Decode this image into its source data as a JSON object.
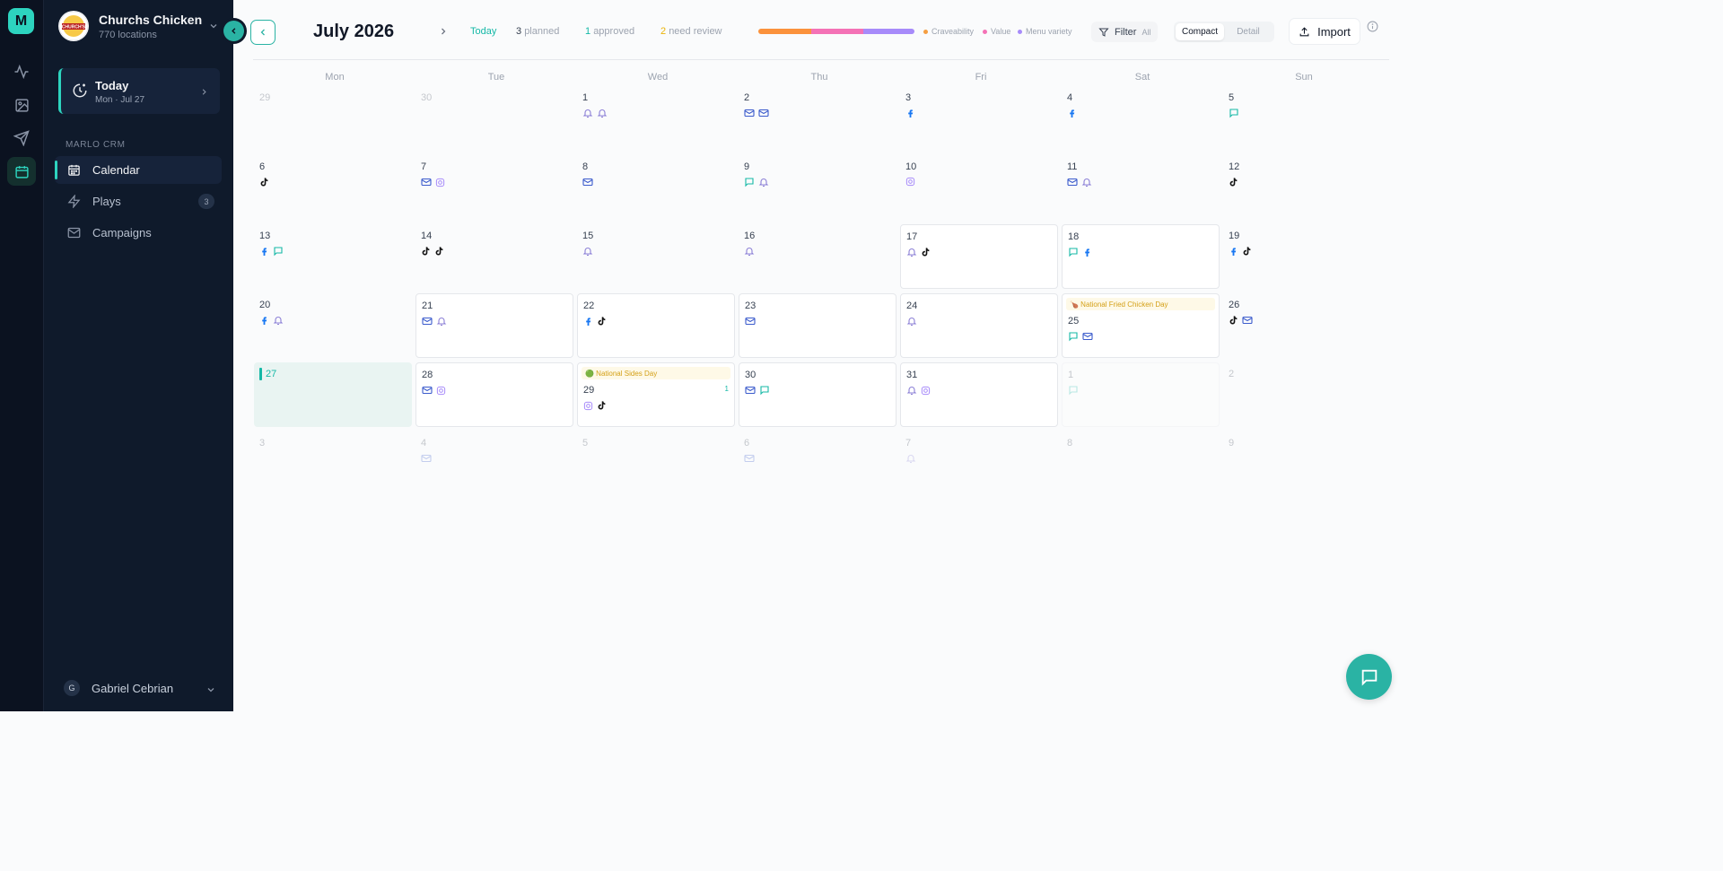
{
  "rail": {
    "logo_letter": "M"
  },
  "org": {
    "name": "Churchs Chicken",
    "locations": "770 locations",
    "logo_text": "CHURCH'S"
  },
  "today_card": {
    "title": "Today",
    "date": "Mon · Jul 27"
  },
  "sidebar": {
    "section_label": "MARLO CRM",
    "items": [
      {
        "label": "Calendar",
        "icon": "calendar-icon",
        "active": true
      },
      {
        "label": "Plays",
        "icon": "lightning-icon",
        "badge": "3"
      },
      {
        "label": "Campaigns",
        "icon": "mail-icon"
      }
    ]
  },
  "user": {
    "initial": "G",
    "name": "Gabriel Cebrian"
  },
  "header": {
    "month": "July 2026",
    "today_label": "Today",
    "planned_count": "3",
    "planned_label": "planned",
    "approved_count": "1",
    "approved_label": "approved",
    "review_count": "2",
    "review_label": "need review",
    "legend": [
      {
        "label": "Craveability",
        "color": "#f59e42"
      },
      {
        "label": "Value",
        "color": "#f472b6"
      },
      {
        "label": "Menu variety",
        "color": "#a78bfa"
      }
    ],
    "bar_segments": [
      {
        "fraction": 0.34,
        "color": "#fb923c"
      },
      {
        "fraction": 0.33,
        "color": "#f472b6"
      },
      {
        "fraction": 0.33,
        "color": "#a78bfa"
      }
    ],
    "filter_label": "Filter",
    "filter_value": "All",
    "view_options": [
      "Compact",
      "Detail"
    ],
    "active_view": "Compact",
    "import_label": "Import"
  },
  "weekdays": [
    "Mon",
    "Tue",
    "Wed",
    "Thu",
    "Fri",
    "Sat",
    "Sun"
  ],
  "colors": {
    "mail": "#3b5bcc",
    "bell": "#8b7fd6",
    "facebook": "#1877f2",
    "tiktok": "#111111",
    "chat": "#14b8a6",
    "instagram": "#a78bfa"
  },
  "calendar": {
    "weeks": [
      [
        {
          "day": "29",
          "state": "faded",
          "icons": []
        },
        {
          "day": "30",
          "state": "faded",
          "icons": []
        },
        {
          "day": "1",
          "icons": [
            "bell",
            "bell"
          ]
        },
        {
          "day": "2",
          "icons": [
            "mail",
            "mail"
          ]
        },
        {
          "day": "3",
          "icons": [
            "facebook"
          ]
        },
        {
          "day": "4",
          "icons": [
            "facebook"
          ]
        },
        {
          "day": "5",
          "icons": [
            "chat"
          ]
        }
      ],
      [
        {
          "day": "6",
          "icons": [
            "tiktok"
          ]
        },
        {
          "day": "7",
          "icons": [
            "mail",
            "instagram"
          ]
        },
        {
          "day": "8",
          "icons": [
            "mail"
          ]
        },
        {
          "day": "9",
          "icons": [
            "chat",
            "bell"
          ]
        },
        {
          "day": "10",
          "icons": [
            "instagram"
          ]
        },
        {
          "day": "11",
          "icons": [
            "mail",
            "bell"
          ]
        },
        {
          "day": "12",
          "icons": [
            "tiktok"
          ]
        }
      ],
      [
        {
          "day": "13",
          "icons": [
            "facebook",
            "chat"
          ]
        },
        {
          "day": "14",
          "icons": [
            "tiktok",
            "tiktok"
          ]
        },
        {
          "day": "15",
          "icons": [
            "bell"
          ]
        },
        {
          "day": "16",
          "icons": [
            "bell"
          ]
        },
        {
          "day": "17",
          "state": "boxed",
          "icons": [
            "bell",
            "tiktok"
          ]
        },
        {
          "day": "18",
          "state": "boxed",
          "icons": [
            "chat",
            "facebook"
          ]
        },
        {
          "day": "19",
          "icons": [
            "facebook",
            "tiktok"
          ]
        }
      ],
      [
        {
          "day": "20",
          "icons": [
            "facebook",
            "bell"
          ]
        },
        {
          "day": "21",
          "state": "boxed",
          "icons": [
            "mail",
            "bell"
          ]
        },
        {
          "day": "22",
          "state": "boxed",
          "icons": [
            "facebook",
            "tiktok"
          ]
        },
        {
          "day": "23",
          "state": "boxed",
          "icons": [
            "mail"
          ]
        },
        {
          "day": "24",
          "state": "boxed",
          "icons": [
            "bell"
          ]
        },
        {
          "day": "25",
          "state": "boxed",
          "event": "🍗 National Fried Chicken Day",
          "icons": [
            "chat",
            "mail"
          ]
        },
        {
          "day": "26",
          "icons": [
            "tiktok",
            "mail"
          ]
        }
      ],
      [
        {
          "day": "27",
          "state": "today",
          "icons": []
        },
        {
          "day": "28",
          "state": "boxed",
          "icons": [
            "mail",
            "instagram"
          ]
        },
        {
          "day": "29",
          "state": "boxed",
          "event": "🟢 National Sides Day",
          "count": "1",
          "icons": [
            "instagram",
            "tiktok"
          ]
        },
        {
          "day": "30",
          "state": "boxed",
          "icons": [
            "mail",
            "chat"
          ]
        },
        {
          "day": "31",
          "state": "boxed",
          "icons": [
            "bell",
            "instagram"
          ]
        },
        {
          "day": "1",
          "state": "faded-boxed",
          "icons": [
            "chat"
          ]
        },
        {
          "day": "2",
          "state": "faded",
          "icons": []
        }
      ],
      [
        {
          "day": "3",
          "state": "faded",
          "icons": []
        },
        {
          "day": "4",
          "state": "faded",
          "icons": [
            "mail"
          ]
        },
        {
          "day": "5",
          "state": "faded",
          "icons": []
        },
        {
          "day": "6",
          "state": "faded",
          "icons": [
            "mail"
          ]
        },
        {
          "day": "7",
          "state": "faded",
          "icons": [
            "bell"
          ]
        },
        {
          "day": "8",
          "state": "faded",
          "icons": []
        },
        {
          "day": "9",
          "state": "faded",
          "icons": []
        }
      ]
    ]
  }
}
